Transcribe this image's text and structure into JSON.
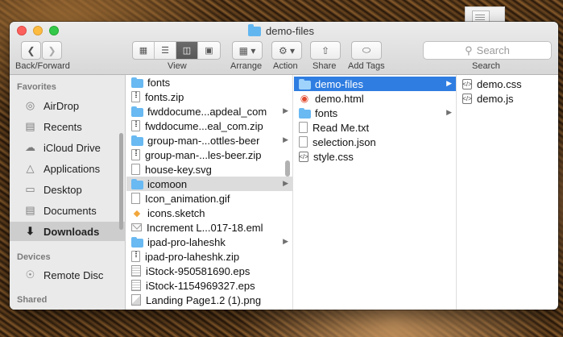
{
  "window": {
    "title": "demo-files"
  },
  "toolbar": {
    "back_forward_label": "Back/Forward",
    "view_label": "View",
    "arrange_label": "Arrange",
    "action_label": "Action",
    "share_label": "Share",
    "add_tags_label": "Add Tags",
    "search_label": "Search",
    "search_placeholder": "Search"
  },
  "sidebar": {
    "favorites_header": "Favorites",
    "devices_header": "Devices",
    "shared_header": "Shared",
    "items": [
      {
        "label": "AirDrop",
        "icon": "airdrop-icon"
      },
      {
        "label": "Recents",
        "icon": "recents-icon"
      },
      {
        "label": "iCloud Drive",
        "icon": "cloud-icon"
      },
      {
        "label": "Applications",
        "icon": "applications-icon"
      },
      {
        "label": "Desktop",
        "icon": "desktop-icon"
      },
      {
        "label": "Documents",
        "icon": "documents-icon"
      },
      {
        "label": "Downloads",
        "icon": "downloads-icon",
        "selected": true
      }
    ],
    "devices": [
      {
        "label": "Remote Disc",
        "icon": "disc-icon"
      }
    ]
  },
  "column1": {
    "items": [
      {
        "name": "fonts",
        "kind": "folder",
        "arrow": false
      },
      {
        "name": "fonts.zip",
        "kind": "zip"
      },
      {
        "name": "fwddocume...apdeal_com",
        "kind": "folder",
        "arrow": true
      },
      {
        "name": "fwddocume...eal_com.zip",
        "kind": "zip"
      },
      {
        "name": "group-man-...ottles-beer",
        "kind": "folder",
        "arrow": true
      },
      {
        "name": "group-man-...les-beer.zip",
        "kind": "zip"
      },
      {
        "name": "house-key.svg",
        "kind": "doc"
      },
      {
        "name": "icomoon",
        "kind": "folder",
        "arrow": true,
        "selected": true
      },
      {
        "name": "Icon_animation.gif",
        "kind": "gif"
      },
      {
        "name": "icons.sketch",
        "kind": "sketch"
      },
      {
        "name": "Increment L...017-18.eml",
        "kind": "mail"
      },
      {
        "name": "ipad-pro-laheshk",
        "kind": "folder",
        "arrow": true
      },
      {
        "name": "ipad-pro-laheshk.zip",
        "kind": "zip"
      },
      {
        "name": "iStock-950581690.eps",
        "kind": "eps"
      },
      {
        "name": "iStock-1154969327.eps",
        "kind": "eps"
      },
      {
        "name": "Landing Page1.2 (1).png",
        "kind": "img"
      }
    ]
  },
  "column2": {
    "items": [
      {
        "name": "demo-files",
        "kind": "folder",
        "arrow": true,
        "selected": true
      },
      {
        "name": "demo.html",
        "kind": "html"
      },
      {
        "name": "fonts",
        "kind": "folder",
        "arrow": true
      },
      {
        "name": "Read Me.txt",
        "kind": "doc"
      },
      {
        "name": "selection.json",
        "kind": "doc"
      },
      {
        "name": "style.css",
        "kind": "code"
      }
    ]
  },
  "column3": {
    "items": [
      {
        "name": "demo.css",
        "kind": "code"
      },
      {
        "name": "demo.js",
        "kind": "code"
      }
    ]
  },
  "colors": {
    "selection_blue": "#2f7de1",
    "folder_blue": "#69b9f2",
    "sidebar_bg": "#eaeaea"
  }
}
